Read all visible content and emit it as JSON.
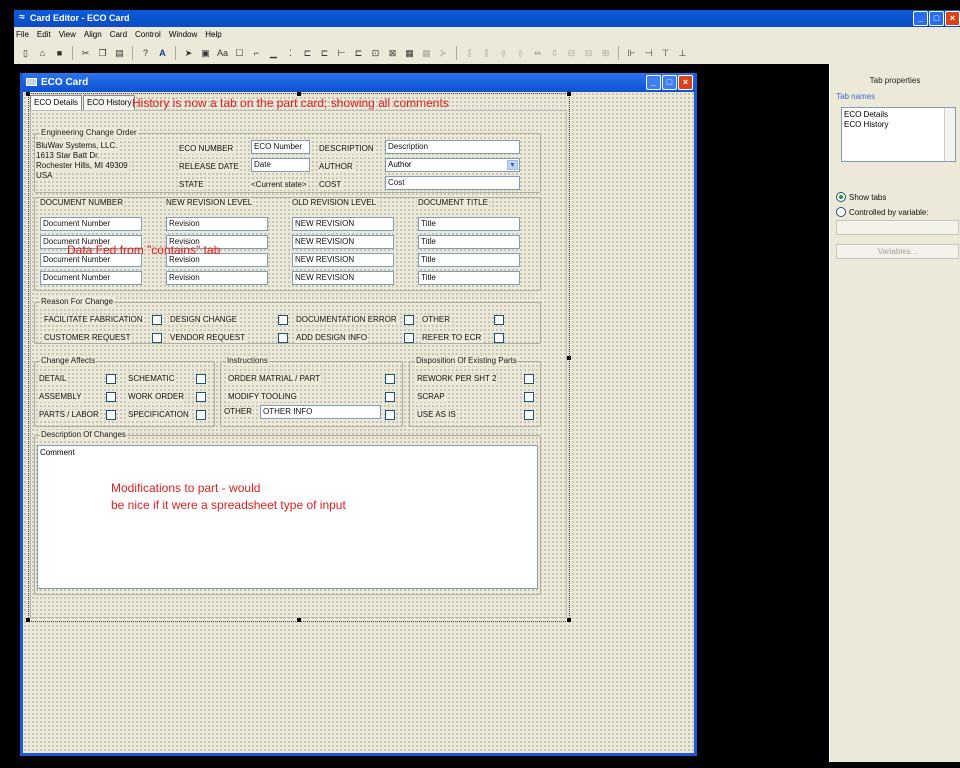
{
  "app": {
    "title": "Card Editor - ECO Card"
  },
  "menu": [
    "File",
    "Edit",
    "View",
    "Align",
    "Card",
    "Control",
    "Window",
    "Help"
  ],
  "toolbar": {
    "icons": [
      "new-icon",
      "open-icon",
      "save-icon",
      "cut-icon",
      "copy-icon",
      "paste-icon",
      "help-icon",
      "font-icon",
      "pointer-icon",
      "image-icon",
      "text-icon",
      "textbox-icon",
      "line-icon",
      "checkbox-icon",
      "field-icon",
      "combo-icon",
      "list-icon",
      "group-icon",
      "button-icon",
      "tab-icon",
      "grid-icon",
      "table-icon",
      "tree-icon"
    ]
  },
  "child": {
    "title": "ECO Card"
  },
  "card": {
    "tabs": [
      "ECO Details",
      "ECO History"
    ],
    "header": {
      "group_label": "Engineering Change Order",
      "company": [
        "BluWav Systems, LLC.",
        "1613 Star Batt Dr.",
        "Rochester Hills, MI 49309",
        "USA"
      ],
      "eco_number_label": "ECO NUMBER",
      "eco_number_value": "ECO Number",
      "release_date_label": "RELEASE DATE",
      "release_date_value": "Date",
      "state_label": "STATE",
      "state_value": "<Current state>",
      "description_label": "DESCRIPTION",
      "description_value": "Description",
      "author_label": "AUTHOR",
      "author_value": "Author",
      "cost_label": "COST",
      "cost_value": "Cost"
    },
    "documents": {
      "headers": [
        "DOCUMENT NUMBER",
        "NEW REVISION LEVEL",
        "OLD REVISION LEVEL",
        "DOCUMENT TITLE"
      ],
      "rows": [
        [
          "Document Number",
          "Revision",
          "NEW REVISION",
          "Title"
        ],
        [
          "Document Number",
          "Revision",
          "NEW REVISION",
          "Title"
        ],
        [
          "Document Number",
          "Revision",
          "NEW REVISION",
          "Title"
        ],
        [
          "Document Number",
          "Revision",
          "NEW REVISION",
          "Title"
        ]
      ]
    },
    "reason": {
      "label": "Reason For Change",
      "items": [
        "FACILITATE FABRICATION",
        "DESIGN CHANGE",
        "DOCUMENTATION ERROR",
        "OTHER",
        "CUSTOMER REQUEST",
        "VENDOR REQUEST",
        "ADD DESIGN INFO",
        "REFER TO ECR"
      ]
    },
    "affects": {
      "label": "Change Affects",
      "items": [
        "DETAIL",
        "SCHEMATIC",
        "ASSEMBLY",
        "WORK ORDER",
        "PARTS / LABOR",
        "SPECIFICATION"
      ]
    },
    "instructions": {
      "label": "Instructions",
      "items": [
        "ORDER MATRIAL / PART",
        "MODIFY TOOLING"
      ],
      "other_label": "OTHER",
      "other_value": "OTHER INFO"
    },
    "disposition": {
      "label": "Disposition Of Existing Parts",
      "items": [
        "REWORK PER SHT 2",
        "SCRAP",
        "USE AS IS"
      ]
    },
    "description": {
      "label": "Description Of Changes",
      "comment": "Comment"
    }
  },
  "annotations": {
    "history": "History is now a tab on the part card; showing all comments",
    "data_fed": "Data Fed from \"contains\" tab",
    "modifications_1": "Modifications to part - would",
    "modifications_2": "be nice if it were a spreadsheet type of input"
  },
  "panel": {
    "title": "Tab properties",
    "names_label": "Tab names",
    "names": [
      "ECO Details",
      "ECO History"
    ],
    "show_tabs": "Show tabs",
    "show_tabs_selected": true,
    "controlled": "Controlled by variable:",
    "variables_button": "Variables..."
  }
}
